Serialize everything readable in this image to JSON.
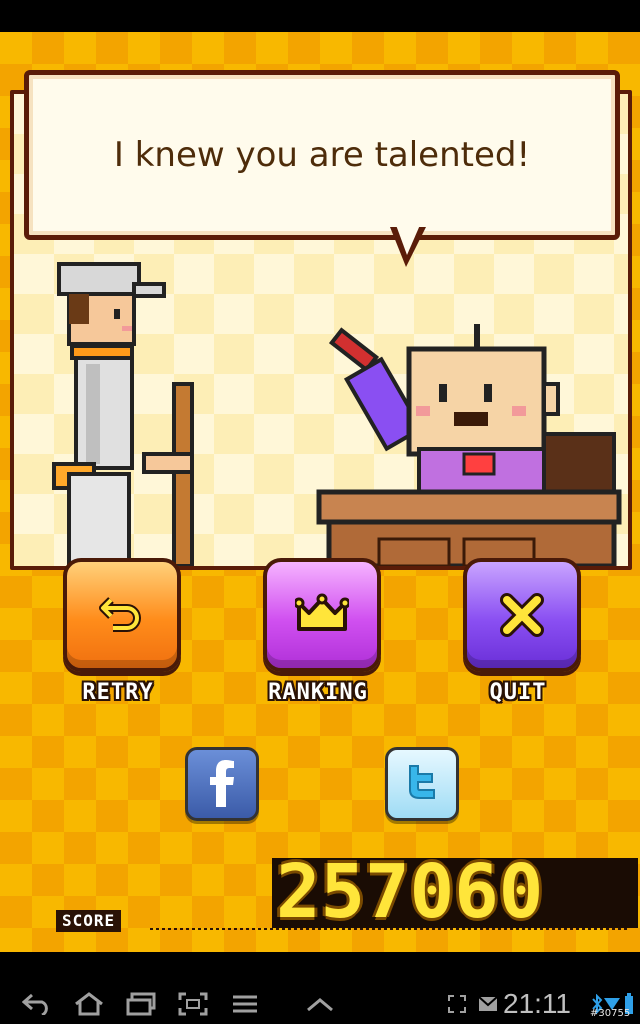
{
  "dialog": {
    "text": "I knew you are talented!"
  },
  "buttons": {
    "retry": {
      "label": "RETRY",
      "icon": "retry-arrow-icon",
      "color": "#ff8c1a"
    },
    "ranking": {
      "label": "RANKING",
      "icon": "crown-icon",
      "color": "#d050f0"
    },
    "quit": {
      "label": "QUIT",
      "icon": "close-x-icon",
      "color": "#8a4ff2"
    }
  },
  "social": {
    "facebook_icon": "facebook-icon",
    "twitter_icon": "twitter-icon"
  },
  "score": {
    "label": "SCORE",
    "value": "257060"
  },
  "system_bar": {
    "time": "21:11",
    "build_id": "#30755",
    "icons": [
      "back-icon",
      "home-icon",
      "recent-apps-icon",
      "screenshot-icon",
      "menu-icon",
      "up-chevron-icon",
      "fullscreen-icon",
      "mail-icon",
      "bluetooth-icon",
      "wifi-icon",
      "battery-icon"
    ]
  },
  "colors": {
    "background": "#f8b800",
    "border": "#5a1c08",
    "score_digits": "#ffe53a"
  }
}
